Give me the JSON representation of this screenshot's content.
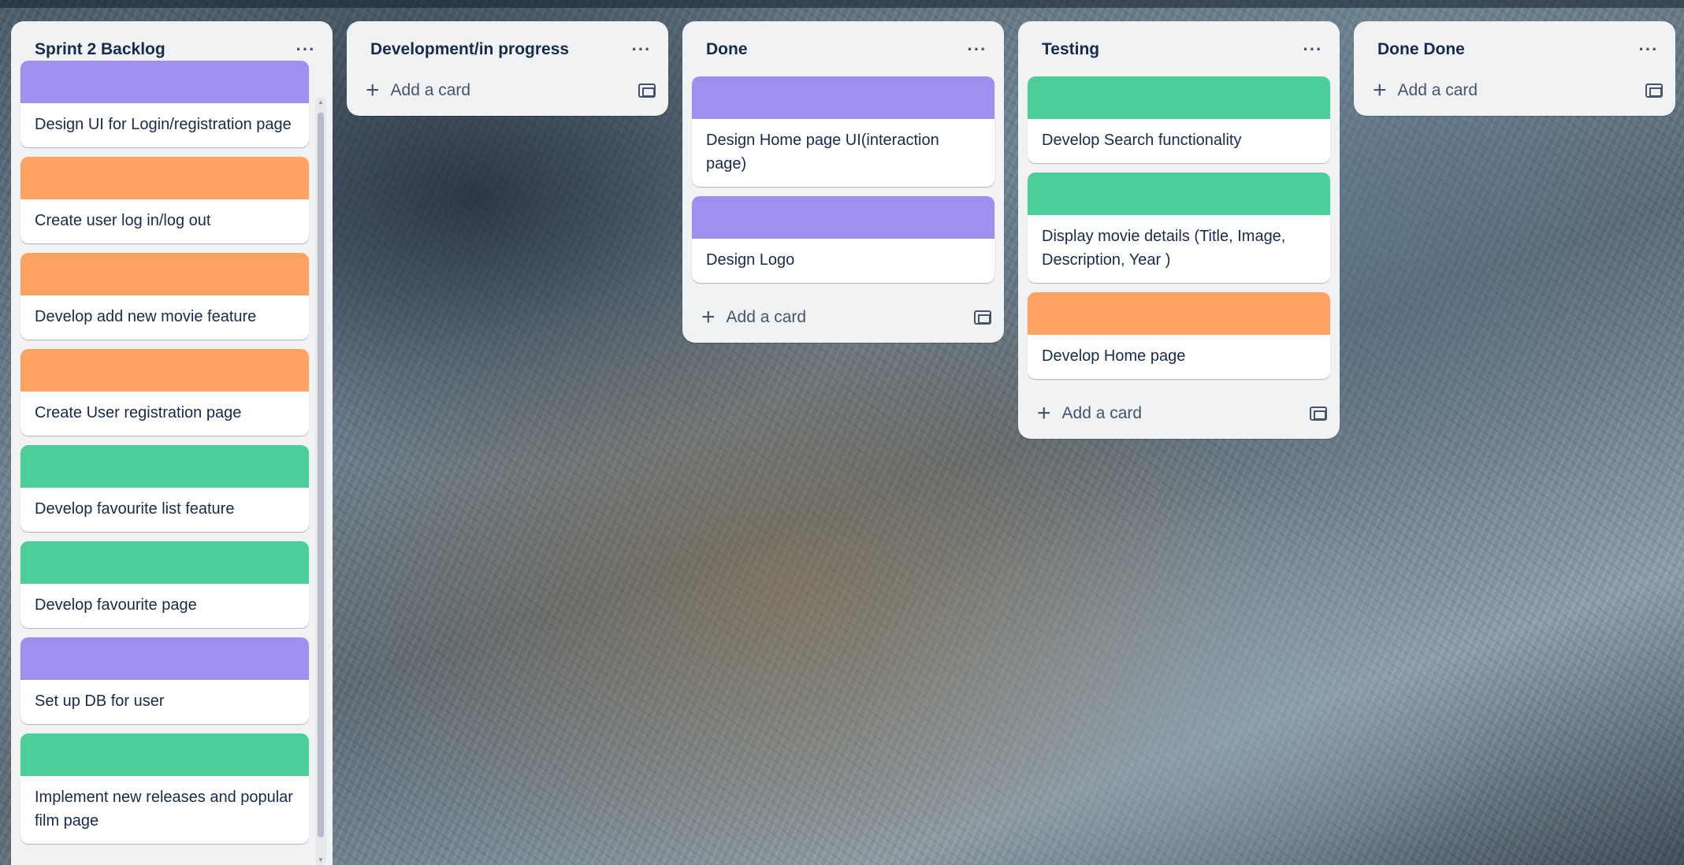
{
  "colors": {
    "purple": "#9f8fef",
    "orange": "#fea362",
    "green": "#4bce97"
  },
  "icons": {
    "list_menu": "ellipsis-icon",
    "add": "plus-icon",
    "template": "card-template-icon"
  },
  "common": {
    "add_card_label": "Add a card",
    "menu_glyph": "···",
    "plus_glyph": "+"
  },
  "lists": [
    {
      "title": "Sprint 2 Backlog",
      "cards": [
        {
          "title": "Design UI for Login/registration page",
          "cover": "purple"
        },
        {
          "title": "Create user log in/log out",
          "cover": "orange"
        },
        {
          "title": "Develop add new movie feature",
          "cover": "orange"
        },
        {
          "title": "Create User registration page",
          "cover": "orange"
        },
        {
          "title": "Develop favourite list feature",
          "cover": "green"
        },
        {
          "title": "Develop favourite page",
          "cover": "green"
        },
        {
          "title": "Set up DB for user",
          "cover": "purple"
        },
        {
          "title": "Implement new releases and popular film page",
          "cover": "green"
        }
      ]
    },
    {
      "title": "Development/in progress",
      "cards": []
    },
    {
      "title": "Done",
      "cards": [
        {
          "title": "Design Home page UI(interaction page)",
          "cover": "purple"
        },
        {
          "title": "Design Logo",
          "cover": "purple"
        }
      ]
    },
    {
      "title": "Testing",
      "cards": [
        {
          "title": "Develop Search functionality",
          "cover": "green"
        },
        {
          "title": "Display movie details (Title, Image, Description, Year )",
          "cover": "green"
        },
        {
          "title": "Develop Home page",
          "cover": "orange"
        }
      ]
    },
    {
      "title": "Done Done",
      "cards": []
    }
  ]
}
